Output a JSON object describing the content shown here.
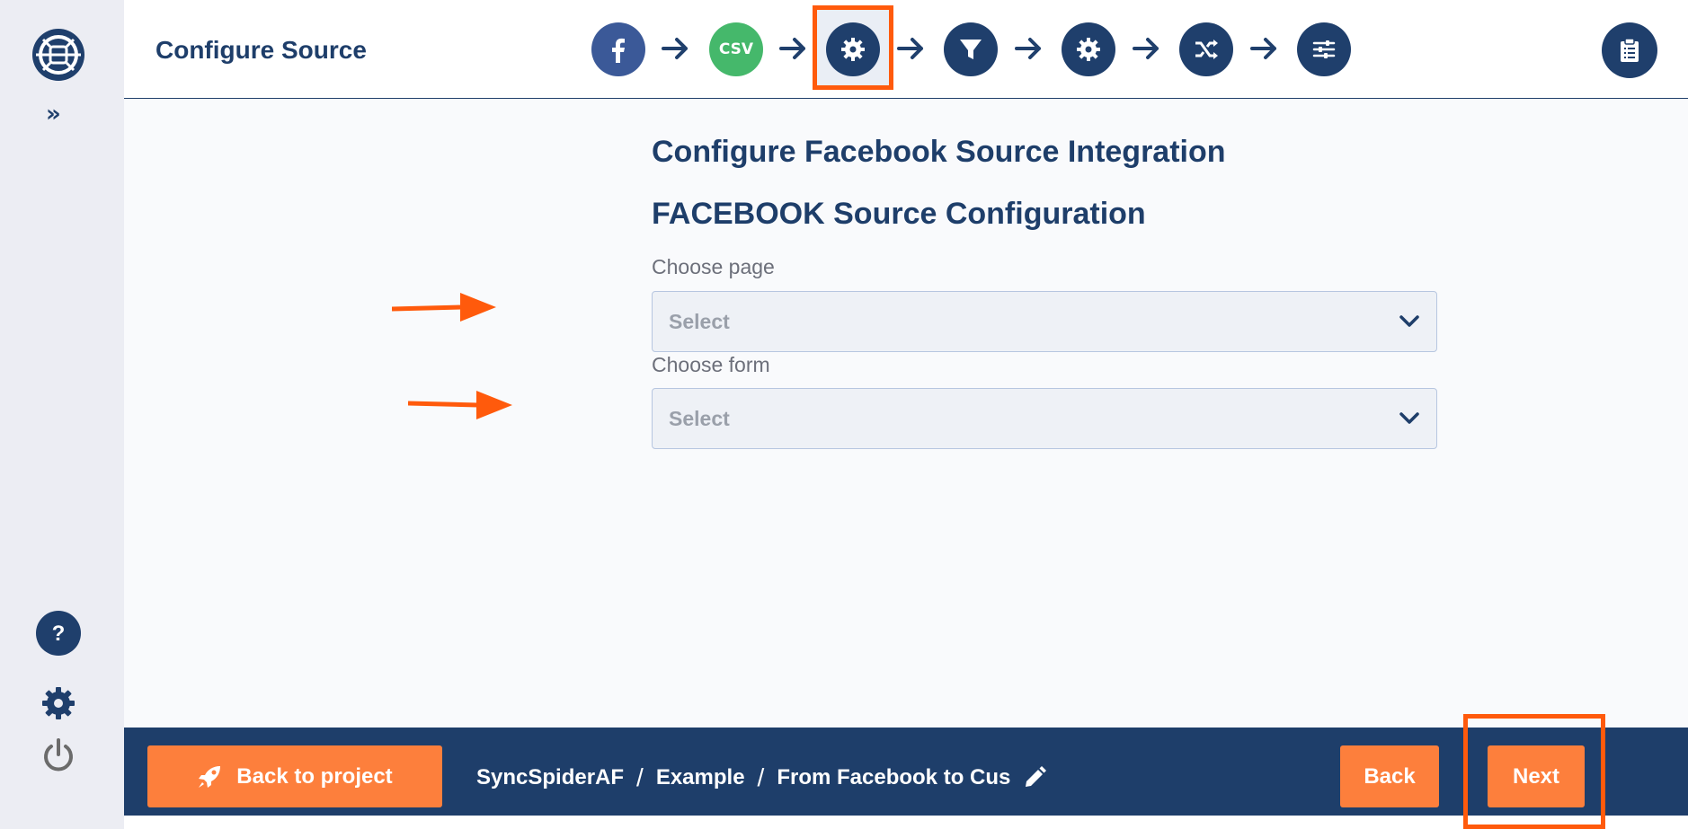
{
  "app": {
    "page_title": "Configure Source"
  },
  "sidebar": {
    "expand_label": "»",
    "help_label": "?"
  },
  "steps": [
    {
      "name": "facebook-icon"
    },
    {
      "name": "csv",
      "label": "CSV"
    },
    {
      "name": "gear-icon",
      "active": true
    },
    {
      "name": "filter-icon"
    },
    {
      "name": "gear-icon"
    },
    {
      "name": "shuffle-icon"
    },
    {
      "name": "sliders-icon"
    }
  ],
  "main": {
    "heading": "Configure Facebook Source Integration",
    "subheading": "FACEBOOK Source Configuration",
    "fields": [
      {
        "label": "Choose page",
        "value": "Select"
      },
      {
        "label": "Choose form",
        "value": "Select"
      }
    ]
  },
  "footer": {
    "back_to_project": "Back to project",
    "breadcrumb": [
      "SyncSpiderAF",
      "Example",
      "From Facebook to Cus"
    ],
    "separator": "/",
    "back": "Back",
    "next": "Next"
  },
  "colors": {
    "primary": "#1e3e6a",
    "accent": "#fd7f3c",
    "annotation": "#ff5a0c",
    "csv": "#45b86b",
    "facebook": "#3b5998"
  }
}
